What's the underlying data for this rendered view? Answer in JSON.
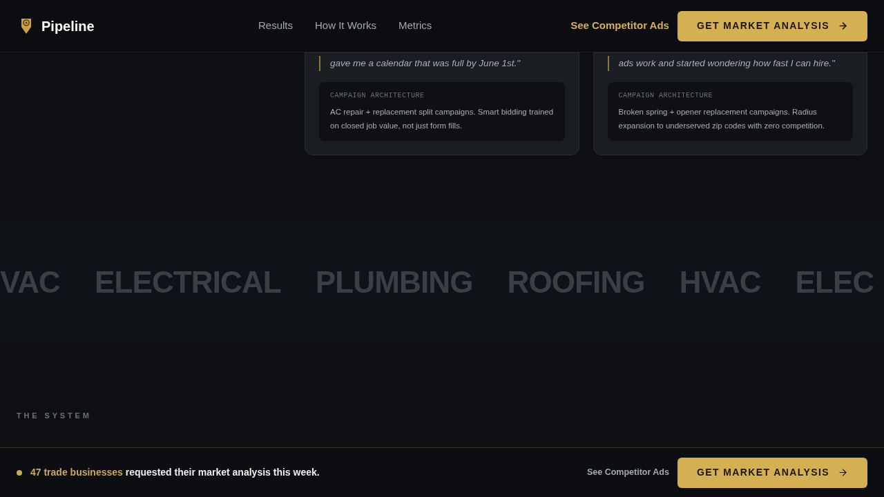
{
  "header": {
    "brand": "Pipeline",
    "nav": [
      {
        "label": "Results"
      },
      {
        "label": "How It Works"
      },
      {
        "label": "Metrics"
      }
    ],
    "link": "See Competitor Ads",
    "cta": "GET MARKET ANALYSIS"
  },
  "cards": [
    {
      "quote": "gave me a calendar that was full by June 1st.\"",
      "label": "CAMPAIGN ARCHITECTURE",
      "text": "AC repair + replacement split campaigns. Smart bidding trained on closed job value, not just form fills."
    },
    {
      "quote": "ads work and started wondering how fast I can hire.\"",
      "label": "CAMPAIGN ARCHITECTURE",
      "text": "Broken spring + opener replacement campaigns. Radius expansion to underserved zip codes with zero competition."
    }
  ],
  "marquee": [
    "VAC",
    "ELECTRICAL",
    "PLUMBING",
    "ROOFING",
    "HVAC",
    "ELEC"
  ],
  "section": {
    "eyebrow": "THE SYSTEM"
  },
  "bottom_bar": {
    "message": "**47 trade businesses** requested their market analysis this week.",
    "link": "See Competitor Ads",
    "cta": "GET MARKET ANALYSIS"
  }
}
